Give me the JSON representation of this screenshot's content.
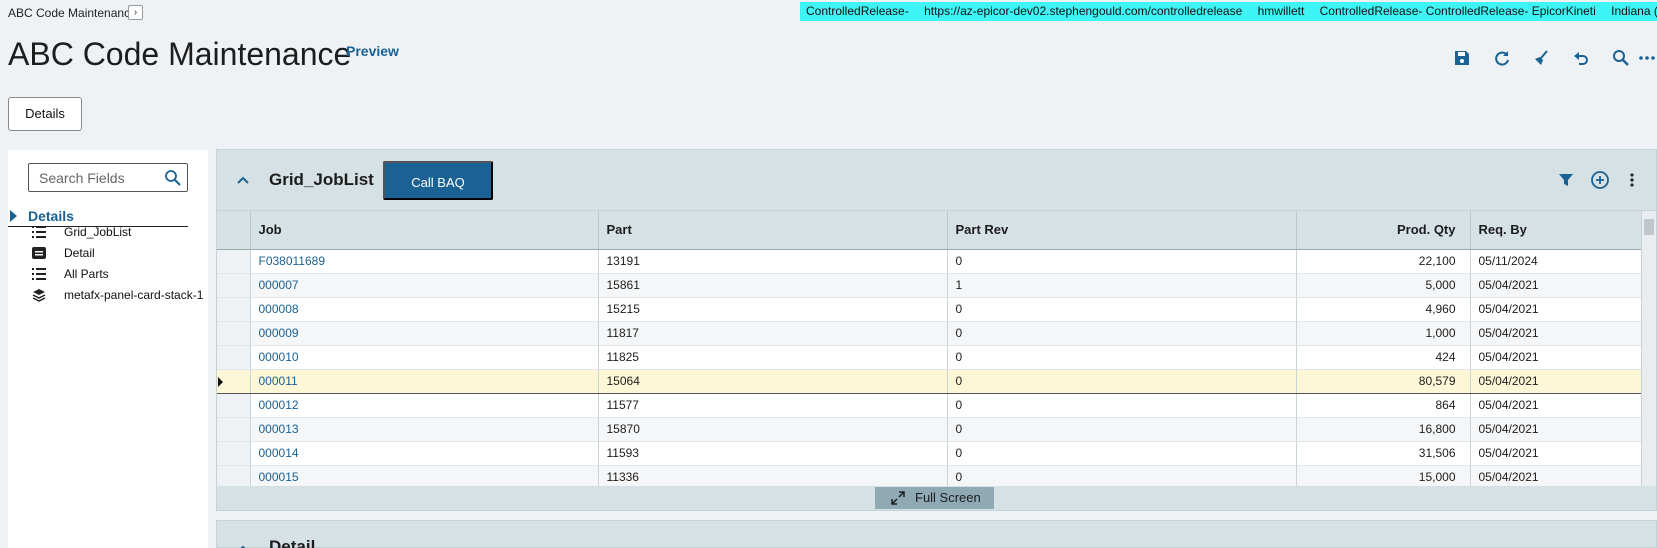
{
  "breadcrumb": {
    "label": "ABC Code Maintenance",
    "expand_glyph": "›"
  },
  "environment": {
    "items": [
      "ControlledRelease-",
      "https://az-epicor-dev02.stephengould.com/controlledrelease",
      "hmwillett",
      "ControlledRelease- ControlledRelease- EpicorKineti",
      "Indiana (Indianapolis"
    ],
    "bg_color": "#3ef4f4"
  },
  "page": {
    "title": "ABC Code Maintenance",
    "preview_label": "Preview"
  },
  "toolbar": {
    "icons": [
      "save-icon",
      "refresh-icon",
      "clear-icon",
      "undo-icon",
      "search-icon",
      "more-icon"
    ]
  },
  "details_button": {
    "label": "Details"
  },
  "sidebar": {
    "search_placeholder": "Search Fields",
    "root_label": "Details",
    "items": [
      {
        "label": "Grid_JobList",
        "icon": "list-icon"
      },
      {
        "label": "Detail",
        "icon": "detail-card-icon"
      },
      {
        "label": "All Parts",
        "icon": "list-icon"
      },
      {
        "label": "metafx-panel-card-stack-1",
        "icon": "layers-icon"
      }
    ]
  },
  "grid_card": {
    "title": "Grid_JobList",
    "call_baq_label": "Call BAQ",
    "columns": [
      "Job",
      "Part",
      "Part Rev",
      "Prod. Qty",
      "Req. By"
    ],
    "rows": [
      {
        "job": "F038011689",
        "part": "13191",
        "rev": "0",
        "qty": "22,100",
        "req_by": "05/11/2024"
      },
      {
        "job": "000007",
        "part": "15861",
        "rev": "1",
        "qty": "5,000",
        "req_by": "05/04/2021"
      },
      {
        "job": "000008",
        "part": "15215",
        "rev": "0",
        "qty": "4,960",
        "req_by": "05/04/2021"
      },
      {
        "job": "000009",
        "part": "11817",
        "rev": "0",
        "qty": "1,000",
        "req_by": "05/04/2021"
      },
      {
        "job": "000010",
        "part": "11825",
        "rev": "0",
        "qty": "424",
        "req_by": "05/04/2021"
      },
      {
        "job": "000011",
        "part": "15064",
        "rev": "0",
        "qty": "80,579",
        "req_by": "05/04/2021"
      },
      {
        "job": "000012",
        "part": "11577",
        "rev": "0",
        "qty": "864",
        "req_by": "05/04/2021"
      },
      {
        "job": "000013",
        "part": "15870",
        "rev": "0",
        "qty": "16,800",
        "req_by": "05/04/2021"
      },
      {
        "job": "000014",
        "part": "11593",
        "rev": "0",
        "qty": "31,506",
        "req_by": "05/04/2021"
      },
      {
        "job": "000015",
        "part": "11336",
        "rev": "0",
        "qty": "15,000",
        "req_by": "05/04/2021"
      }
    ],
    "selected_row": 5,
    "full_screen_label": "Full Screen"
  },
  "detail_card": {
    "title": "Detail"
  },
  "colors": {
    "accent": "#1a6194",
    "selected_row": "#fdf7d8"
  }
}
